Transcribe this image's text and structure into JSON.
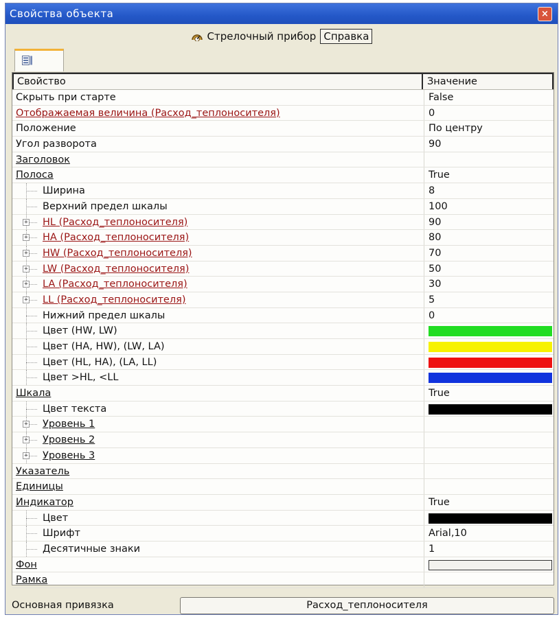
{
  "window": {
    "title": "Свойства объекта",
    "close_glyph": "×"
  },
  "header": {
    "object_type": "Стрелочный прибор",
    "help_label": "Справка"
  },
  "tab": {
    "icon": "property-list-icon"
  },
  "columns": {
    "property": "Свойство",
    "value": "Значение"
  },
  "rows": [
    {
      "name": "Скрыть при старте",
      "value": "False",
      "level": 0,
      "style": "plain"
    },
    {
      "name": "Отображаемая величина (Расход_теплоносителя)",
      "value": "0",
      "level": 0,
      "style": "link-red"
    },
    {
      "name": "Положение",
      "value": "По центру",
      "level": 0,
      "style": "plain"
    },
    {
      "name": "Угол разворота",
      "value": "90",
      "level": 0,
      "style": "plain"
    },
    {
      "name": "Заголовок",
      "value": "",
      "level": 0,
      "style": "link"
    },
    {
      "name": "Полоса",
      "value": "True",
      "level": 0,
      "style": "link"
    },
    {
      "name": "Ширина",
      "value": "8",
      "level": 1,
      "style": "plain"
    },
    {
      "name": "Верхний предел шкалы",
      "value": "100",
      "level": 1,
      "style": "plain"
    },
    {
      "name": "HL (Расход_теплоносителя)",
      "value": "90",
      "level": 1,
      "style": "link-red",
      "expand": true
    },
    {
      "name": "HA (Расход_теплоносителя)",
      "value": "80",
      "level": 1,
      "style": "link-red",
      "expand": true
    },
    {
      "name": "HW (Расход_теплоносителя)",
      "value": "70",
      "level": 1,
      "style": "link-red",
      "expand": true
    },
    {
      "name": "LW (Расход_теплоносителя)",
      "value": "50",
      "level": 1,
      "style": "link-red",
      "expand": true
    },
    {
      "name": "LA (Расход_теплоносителя)",
      "value": "30",
      "level": 1,
      "style": "link-red",
      "expand": true
    },
    {
      "name": "LL (Расход_теплоносителя)",
      "value": "5",
      "level": 1,
      "style": "link-red",
      "expand": true
    },
    {
      "name": "Нижний предел шкалы",
      "value": "0",
      "level": 1,
      "style": "plain"
    },
    {
      "name": "Цвет (HW, LW)",
      "value": "",
      "level": 1,
      "style": "plain",
      "color": "#22dd22"
    },
    {
      "name": "Цвет (HA, HW), (LW, LA)",
      "value": "",
      "level": 1,
      "style": "plain",
      "color": "#f7f200"
    },
    {
      "name": "Цвет (HL, HA), (LA, LL)",
      "value": "",
      "level": 1,
      "style": "plain",
      "color": "#ee1111"
    },
    {
      "name": "Цвет >HL, <LL",
      "value": "",
      "level": 1,
      "style": "plain",
      "color": "#1133dd"
    },
    {
      "name": "Шкала",
      "value": "True",
      "level": 0,
      "style": "link"
    },
    {
      "name": "Цвет текста",
      "value": "",
      "level": 1,
      "style": "plain",
      "color": "#000000"
    },
    {
      "name": "Уровень 1",
      "value": "",
      "level": 1,
      "style": "link",
      "expand": true
    },
    {
      "name": "Уровень 2",
      "value": "",
      "level": 1,
      "style": "link",
      "expand": true
    },
    {
      "name": "Уровень 3",
      "value": "",
      "level": 1,
      "style": "link",
      "expand": true
    },
    {
      "name": "Указатель",
      "value": "",
      "level": 0,
      "style": "link"
    },
    {
      "name": "Единицы",
      "value": "",
      "level": 0,
      "style": "link"
    },
    {
      "name": "Индикатор",
      "value": "True",
      "level": 0,
      "style": "link"
    },
    {
      "name": "Цвет",
      "value": "",
      "level": 1,
      "style": "plain",
      "color": "#000000"
    },
    {
      "name": "Шрифт",
      "value": "Arial,10",
      "level": 1,
      "style": "plain"
    },
    {
      "name": "Десятичные знаки",
      "value": "1",
      "level": 1,
      "style": "plain"
    },
    {
      "name": "Фон",
      "value": "",
      "level": 0,
      "style": "link",
      "color": "outline"
    },
    {
      "name": "Рамка",
      "value": "",
      "level": 0,
      "style": "link"
    }
  ],
  "footer": {
    "binding_label": "Основная привязка",
    "binding_value": "Расход_теплоносителя"
  }
}
